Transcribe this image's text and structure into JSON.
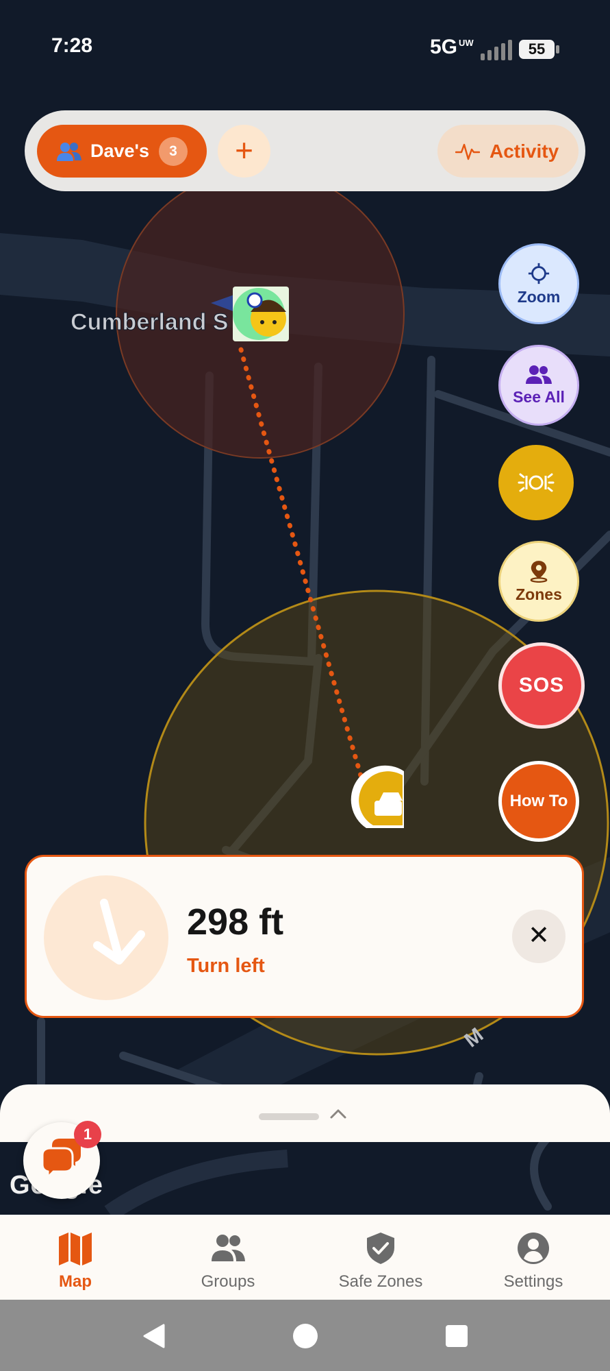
{
  "status_bar": {
    "time": "7:28",
    "network": "5G",
    "network_sub": "UW",
    "battery": "55"
  },
  "map": {
    "street_label": "Cumberland S",
    "street_label_2": "M",
    "google_logo": "Google"
  },
  "top_bar": {
    "group_name": "Dave's",
    "group_count": "3",
    "add_label": "+",
    "activity_label": "Activity"
  },
  "fabs": {
    "zoom": "Zoom",
    "see_all": "See All",
    "zones": "Zones",
    "sos": "SOS",
    "how_to": "How To"
  },
  "direction": {
    "distance": "298 ft",
    "instruction": "Turn left",
    "close": "✕"
  },
  "chat": {
    "badge": "1"
  },
  "nav": {
    "items": [
      {
        "label": "Map",
        "icon": "map-icon",
        "active": true
      },
      {
        "label": "Groups",
        "icon": "groups-icon",
        "active": false
      },
      {
        "label": "Safe Zones",
        "icon": "shield-check-icon",
        "active": false
      },
      {
        "label": "Settings",
        "icon": "account-icon",
        "active": false
      }
    ]
  },
  "colors": {
    "accent": "#e55712",
    "map_bg": "#111a29",
    "sos": "#ea4447",
    "zone_yellow": "#e4ad0d"
  }
}
